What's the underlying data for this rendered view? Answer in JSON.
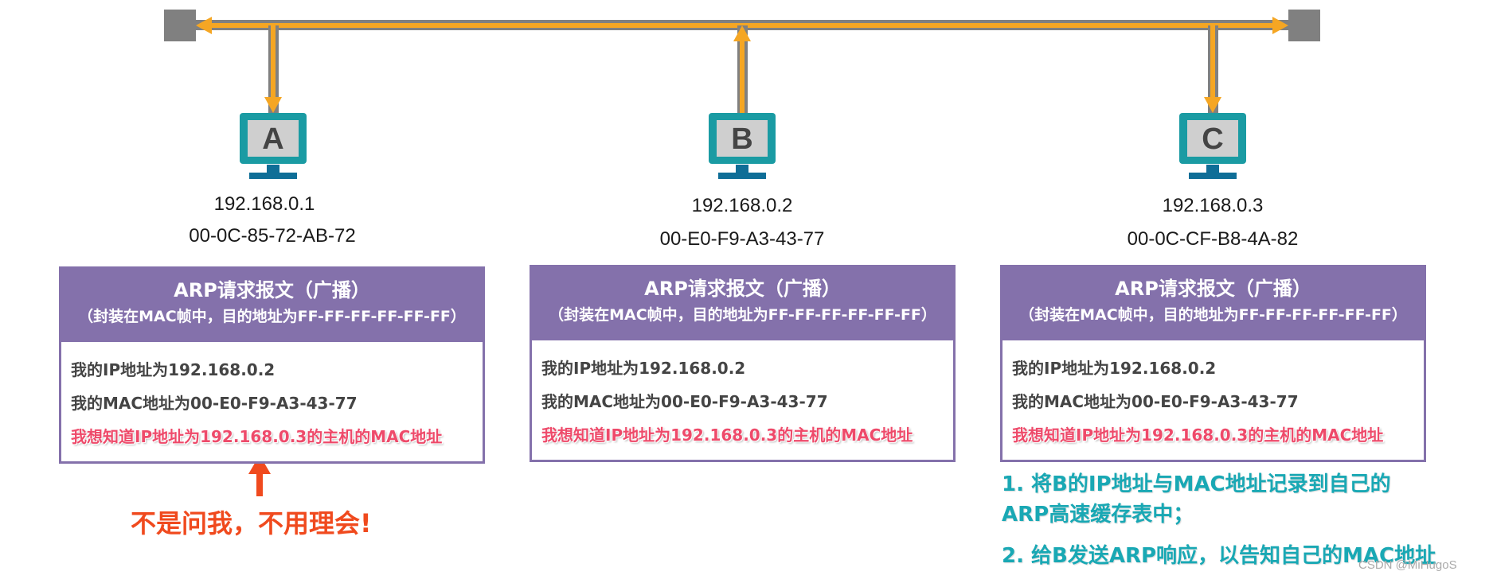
{
  "hosts": [
    {
      "letter": "A",
      "ip": "192.168.0.1",
      "mac": "00-0C-85-72-AB-72"
    },
    {
      "letter": "B",
      "ip": "192.168.0.2",
      "mac": "00-E0-F9-A3-43-77"
    },
    {
      "letter": "C",
      "ip": "192.168.0.3",
      "mac": "00-0C-CF-B8-4A-82"
    }
  ],
  "arp_packet": {
    "title": "ARP请求报文（广播）",
    "subtitle": "（封装在MAC帧中，目的地址为FF-FF-FF-FF-FF-FF）",
    "line_ip": "我的IP地址为192.168.0.2",
    "line_mac": "我的MAC地址为00-E0-F9-A3-43-77",
    "line_query": "我想知道IP地址为192.168.0.3的主机的MAC地址"
  },
  "annotation_a": "不是问我，不用理会!",
  "notes_c": {
    "step1_line1": "1. 将B的IP地址与MAC地址记录到自己的",
    "step1_line2": "ARP高速缓存表中；",
    "step2": "2. 给B发送ARP响应，以告知自己的MAC地址"
  },
  "watermark": "CSDN @MiHugoS",
  "colors": {
    "bus": "#808080",
    "signal": "#f5a623",
    "monitor_frame": "#1a9ba3",
    "monitor_screen": "#cfcfcf",
    "monitor_stand": "#0f6e97",
    "packet_header": "#8471ab",
    "query_text": "#ee4a6a",
    "annotation_arrow": "#f04a1e",
    "notes_text": "#19a8b4"
  }
}
